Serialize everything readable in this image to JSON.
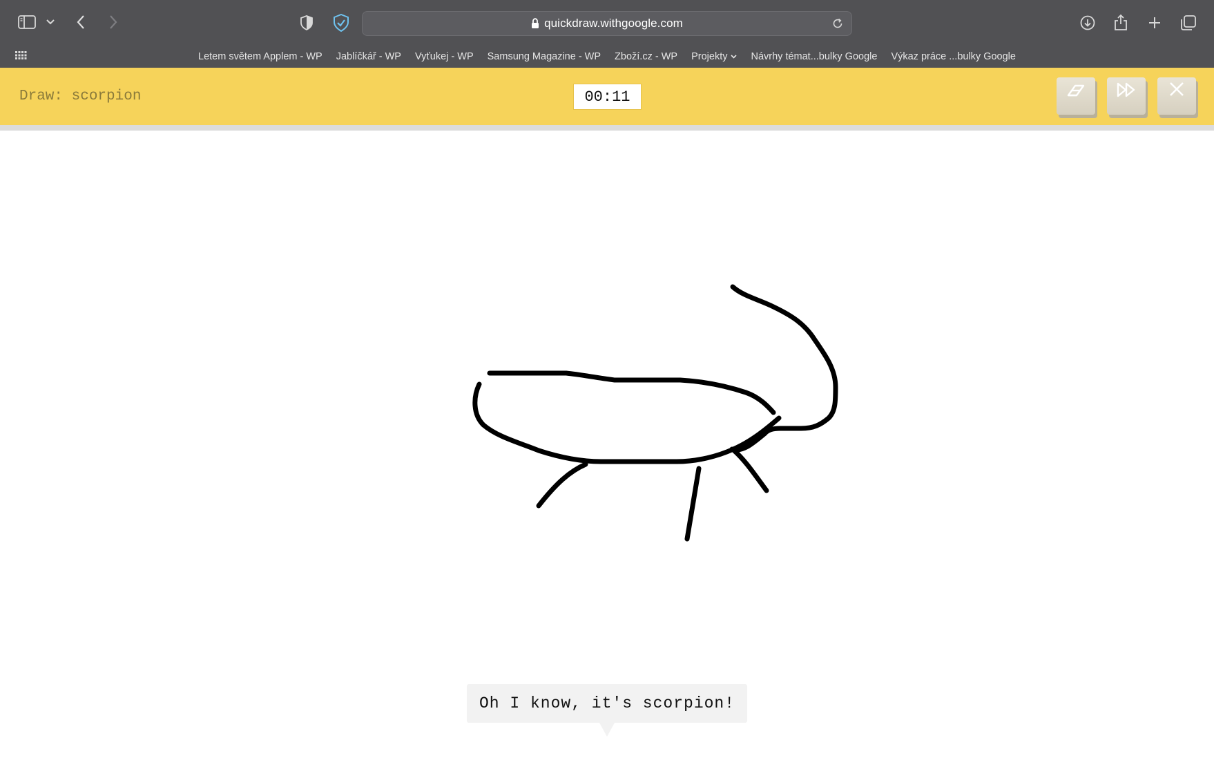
{
  "browser": {
    "url": "quickdraw.withgoogle.com",
    "bookmarks": [
      {
        "label": "Letem světem Applem - WP"
      },
      {
        "label": "Jablíčkář - WP"
      },
      {
        "label": "Vyťukej - WP"
      },
      {
        "label": "Samsung Magazine - WP"
      },
      {
        "label": "Zboží.cz - WP"
      },
      {
        "label": "Projekty"
      },
      {
        "label": "Návrhy témat...bulky Google"
      },
      {
        "label": "Výkaz práce ...bulky Google"
      }
    ],
    "icons": {
      "sidebar": "sidebar-icon",
      "back": "chevron-left-icon",
      "forward": "chevron-right-icon",
      "privacy": "shield-half-icon",
      "vpn": "shield-check-icon",
      "download": "download-icon",
      "share": "share-icon",
      "new_tab": "plus-icon",
      "tabs": "tab-overview-icon"
    }
  },
  "game": {
    "prompt": "Draw: scorpion",
    "timer": "00:11",
    "guess": "Oh I know, it's scorpion!",
    "buttons": {
      "clear": "eraser-icon",
      "skip": "skip-icon",
      "close": "close-icon"
    },
    "colors": {
      "header": "#f6d35a",
      "stroke": "#000000"
    }
  }
}
